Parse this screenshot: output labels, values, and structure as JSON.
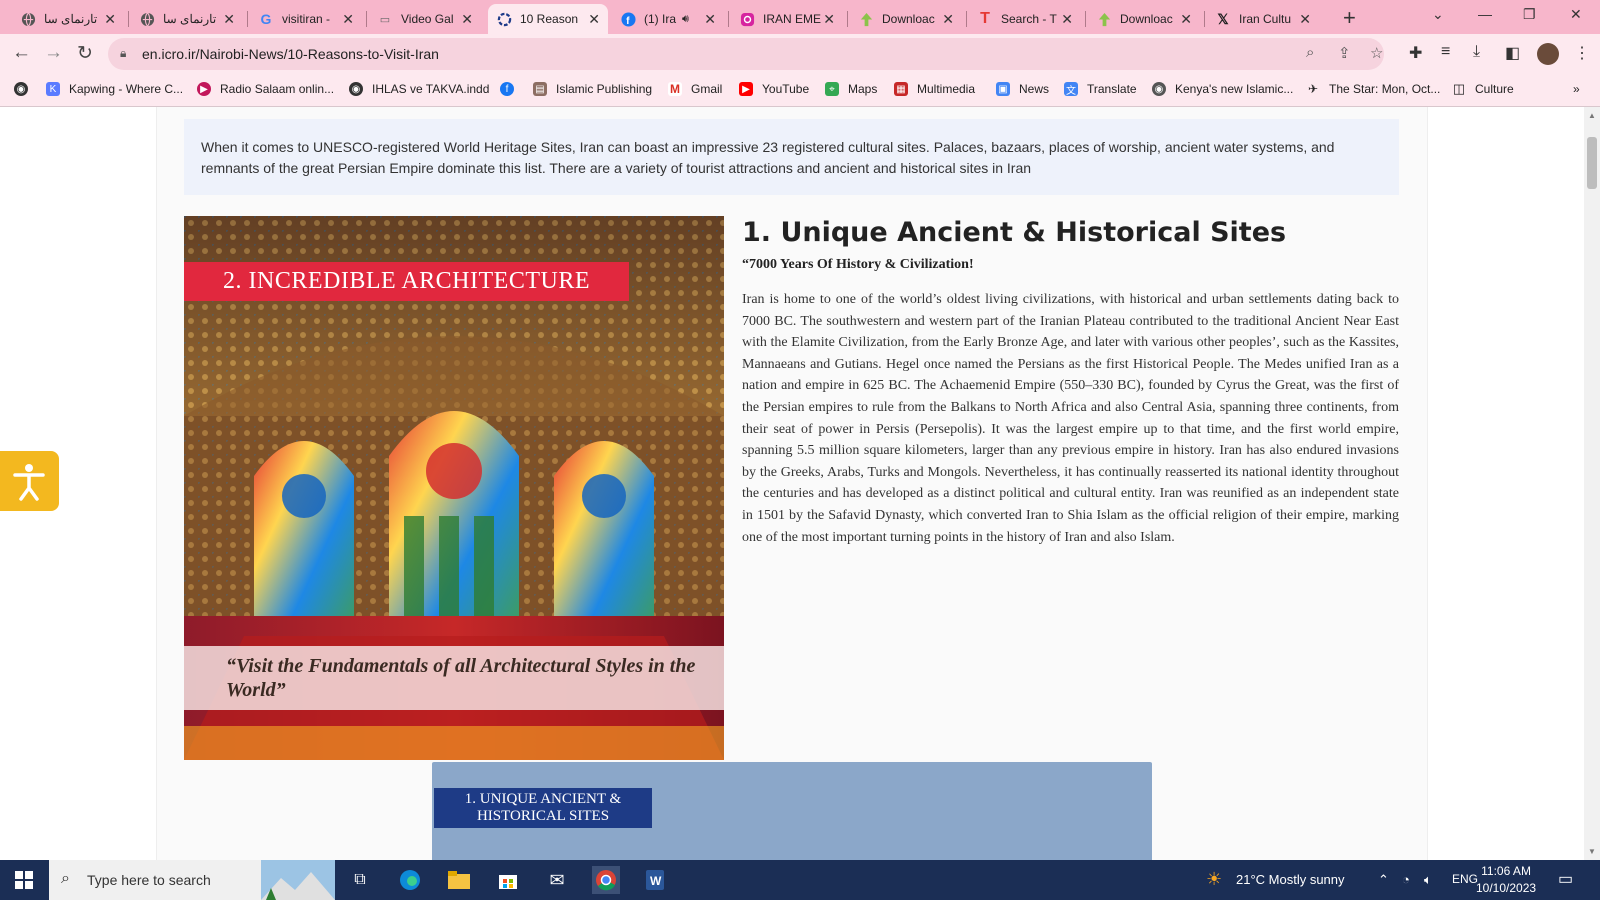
{
  "tabs": [
    {
      "title": "تارنمای سا",
      "icon": "globe-icon"
    },
    {
      "title": "تارنمای سا",
      "icon": "globe-icon"
    },
    {
      "title": "visitiran -",
      "icon": "google-icon"
    },
    {
      "title": "Video Gal",
      "icon": "video-icon"
    },
    {
      "title": "10 Reason",
      "icon": "loading-icon",
      "active": true
    },
    {
      "title": "(1) Ira",
      "icon": "facebook-icon",
      "audio": true
    },
    {
      "title": "IRAN EME",
      "icon": "instagram-icon"
    },
    {
      "title": "Downloac",
      "icon": "download-icon"
    },
    {
      "title": "Search - T",
      "icon": "t-icon"
    },
    {
      "title": "Downloac",
      "icon": "download-icon"
    },
    {
      "title": "Iran Cultu",
      "icon": "x-icon"
    }
  ],
  "address": {
    "url": "en.icro.ir/Nairobi-News/10-Reasons-to-Visit-Iran"
  },
  "bookmarks": [
    {
      "label": "",
      "icon": "globe-icon"
    },
    {
      "label": "Kapwing - Where C...",
      "icon": "kapwing-icon"
    },
    {
      "label": "Radio Salaam onlin...",
      "icon": "play-icon"
    },
    {
      "label": "IHLAS ve TAKVA.indd",
      "icon": "globe-icon"
    },
    {
      "label": "",
      "icon": "facebook-icon"
    },
    {
      "label": "Islamic Publishing",
      "icon": "book-icon"
    },
    {
      "label": "Gmail",
      "icon": "gmail-icon"
    },
    {
      "label": "YouTube",
      "icon": "youtube-icon"
    },
    {
      "label": "Maps",
      "icon": "maps-icon"
    },
    {
      "label": "Multimedia",
      "icon": "multimedia-icon"
    },
    {
      "label": "News",
      "icon": "news-icon"
    },
    {
      "label": "Translate",
      "icon": "translate-icon"
    },
    {
      "label": "Kenya's new Islamic...",
      "icon": "globe-icon"
    },
    {
      "label": "The Star: Mon, Oct...",
      "icon": "star-icon"
    },
    {
      "label": "Culture",
      "icon": "folder-icon"
    }
  ],
  "article": {
    "intro": "When it comes to UNESCO-registered World Heritage Sites, Iran can boast an impressive 23 registered cultural sites. Palaces, bazaars, places of worship, ancient water systems, and remnants of the great Persian Empire dominate this list. There are a variety of tourist attractions and ancient and historical sites in Iran",
    "image_banner": "2. INCREDIBLE ARCHITECTURE",
    "image_quote": "“Visit the Fundamentals of all Architectural Styles in the World”",
    "heading": "1. Unique Ancient & Historical Sites",
    "subtitle": "“7000 Years Of History & Civilization!",
    "body": "Iran is home to one of the world’s oldest living civilizations, with historical and urban settlements dating back to 7000 BC. The southwestern and western part of the Iranian Plateau contributed to the traditional Ancient Near East with the Elamite Civilization, from the Early Bronze Age, and later with various other peoples’, such as the Kassites, Mannaeans and Gutians. Hegel once named the Persians as the first Historical People. The Medes unified Iran as a nation and empire in 625 BC. The Achaemenid Empire (550–330 BC), founded by Cyrus the Great, was the first of the Persian empires to rule from the Balkans to North Africa and also Central Asia, spanning three continents, from their seat of power in Persis (Persepolis). It was the largest empire up to that time, and the first world empire, spanning 5.5 million square kilometers, larger than any previous empire in history. Iran has also endured invasions by the Greeks, Arabs, Turks and Mongols. Nevertheless, it has continually reasserted its national identity throughout the centuries and has developed as a distinct political and cultural entity. Iran was reunified as an independent state in 1501 by the Safavid Dynasty, which converted Iran to Shia Islam as the official religion of their empire, marking one of the most important turning points in the history of Iran and also Islam.",
    "card_label": "1. UNIQUE ANCIENT & HISTORICAL SITES"
  },
  "taskbar": {
    "search_placeholder": "Type here to search",
    "weather": "21°C  Mostly sunny",
    "language": "ENG",
    "time": "11:06 AM",
    "date": "10/10/2023"
  },
  "colors": {
    "tabbar": "#f7b6cb",
    "toolbar": "#fde9ef",
    "banner": "#e1283e",
    "card": "#8ba7c9",
    "accessibility": "#f3b81f",
    "taskbar": "#1b2e55"
  }
}
